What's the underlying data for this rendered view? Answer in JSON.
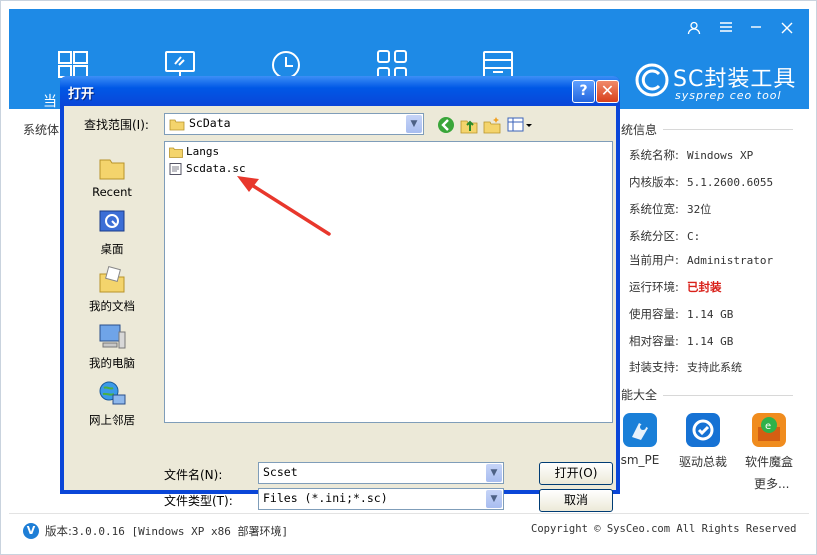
{
  "app": {
    "nav_first_label": "当",
    "logo_main": "SC封装工具",
    "logo_sub": "sysprep ceo tool",
    "section_system": "系统体",
    "info_title": "统信息",
    "info": [
      {
        "key": "系统名称:",
        "value": "Windows XP"
      },
      {
        "key": "内核版本:",
        "value": "5.1.2600.6055"
      },
      {
        "key": "系统位宽:",
        "value": "32位"
      },
      {
        "key": "系统分区:",
        "value": "C:"
      },
      {
        "key": "当前用户:",
        "value": "Administrator"
      },
      {
        "key": "运行环境:",
        "value": "已封装"
      },
      {
        "key": "使用容量:",
        "value": "1.14 GB"
      },
      {
        "key": "相对容量:",
        "value": "1.14 GB"
      },
      {
        "key": "封装支持:",
        "value": "支持此系统"
      }
    ],
    "tools_title": "能大全",
    "tools": [
      {
        "label": "sm_PE"
      },
      {
        "label": "驱动总裁"
      },
      {
        "label": "软件魔盒"
      }
    ],
    "more": "更多...",
    "version_badge": "V",
    "version_label": "版本:",
    "version_value": "3.0.0.16 [Windows XP x86 部署环境]",
    "copyright": "Copyright © SysCeo.com All Rights Reserved"
  },
  "dialog": {
    "title": "打开",
    "help": "?",
    "close": "✕",
    "look_in_label": "查找范围(I):",
    "look_in_value": "ScData",
    "places": [
      "Recent",
      "桌面",
      "我的文档",
      "我的电脑",
      "网上邻居"
    ],
    "files": [
      {
        "name": "Langs",
        "type": "folder"
      },
      {
        "name": "Scdata.sc",
        "type": "file"
      }
    ],
    "filename_label": "文件名(N):",
    "filename_value": "Scset",
    "filetype_label": "文件类型(T):",
    "filetype_value": "Files (*.ini;*.sc)",
    "open_button": "打开(O)",
    "cancel_button": "取消"
  },
  "colors": {
    "header": "#1e8ae6",
    "xp_title": "#0a46d8",
    "dialog_bg": "#ece9d8",
    "annotation_arrow": "#e8372c",
    "status_red": "#d9211a"
  }
}
